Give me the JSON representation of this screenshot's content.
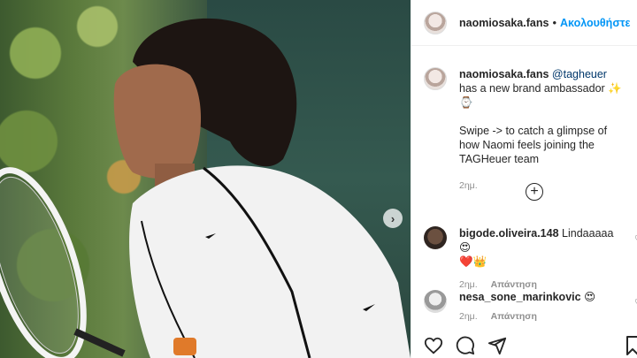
{
  "post": {
    "username": "naomiosaka.fans",
    "follow_label": "Ακολουθήστε",
    "separator": "•"
  },
  "caption": {
    "username": "naomiosaka.fans",
    "mention": "@tagheuer",
    "text1": " has a new brand ambassador ✨⌚",
    "text2": "Swipe -> to catch a glimpse of how Naomi feels joining the TAGHeuer team",
    "time": "2ημ."
  },
  "comments": [
    {
      "username": "bigode.oliveira.148",
      "text": "Lindaaaaa😍",
      "emoji_line": "❤️👑",
      "time": "2ημ.",
      "reply": "Απάντηση"
    },
    {
      "username": "nesa_sone_marinkovic",
      "text": "😍",
      "time": "2ημ.",
      "reply": "Απάντηση"
    }
  ],
  "icons": {
    "next": "chevron-right-icon",
    "load_more": "plus-circle-icon",
    "like": "heart-icon",
    "comment": "comment-icon",
    "share": "share-icon",
    "save": "bookmark-icon"
  },
  "colors": {
    "follow": "#0095f6",
    "mention": "#00376b",
    "muted": "#8e8e8e"
  }
}
